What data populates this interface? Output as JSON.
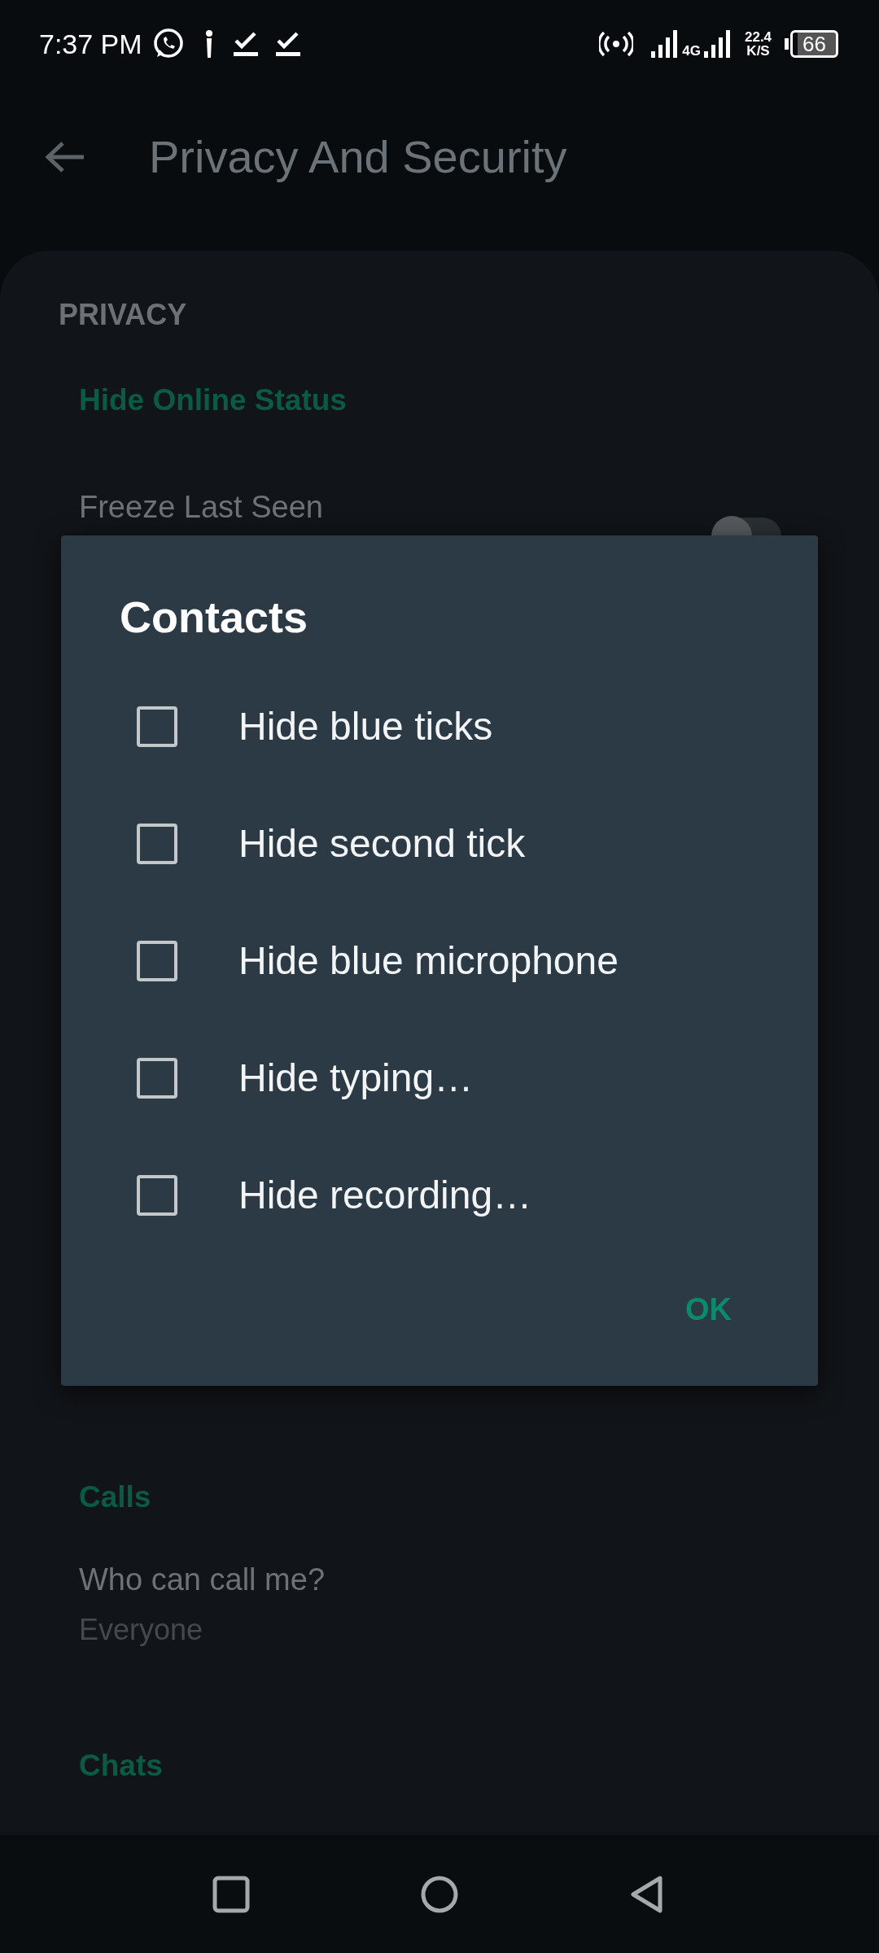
{
  "status_bar": {
    "time": "7:37 PM",
    "network_type": "4G",
    "speed_value": "22.4",
    "speed_unit": "K/S",
    "battery": "66"
  },
  "app_bar": {
    "title": "Privacy And Security"
  },
  "background": {
    "section_title": "PRIVACY",
    "groups": [
      {
        "title": "Hide Online Status",
        "items": [
          {
            "title": "Freeze Last Seen",
            "toggle": {
              "on": false
            }
          }
        ]
      }
    ],
    "lower_groups": [
      {
        "title": "Calls",
        "items": [
          {
            "title": "Who can call me?",
            "subtitle": "Everyone"
          }
        ]
      },
      {
        "title": "Chats"
      }
    ]
  },
  "dialog": {
    "title": "Contacts",
    "options": [
      {
        "label": "Hide blue ticks",
        "checked": false
      },
      {
        "label": "Hide second tick",
        "checked": false
      },
      {
        "label": "Hide blue microphone",
        "checked": false
      },
      {
        "label": "Hide typing…",
        "checked": false
      },
      {
        "label": "Hide recording…",
        "checked": false
      }
    ],
    "button": "OK"
  }
}
